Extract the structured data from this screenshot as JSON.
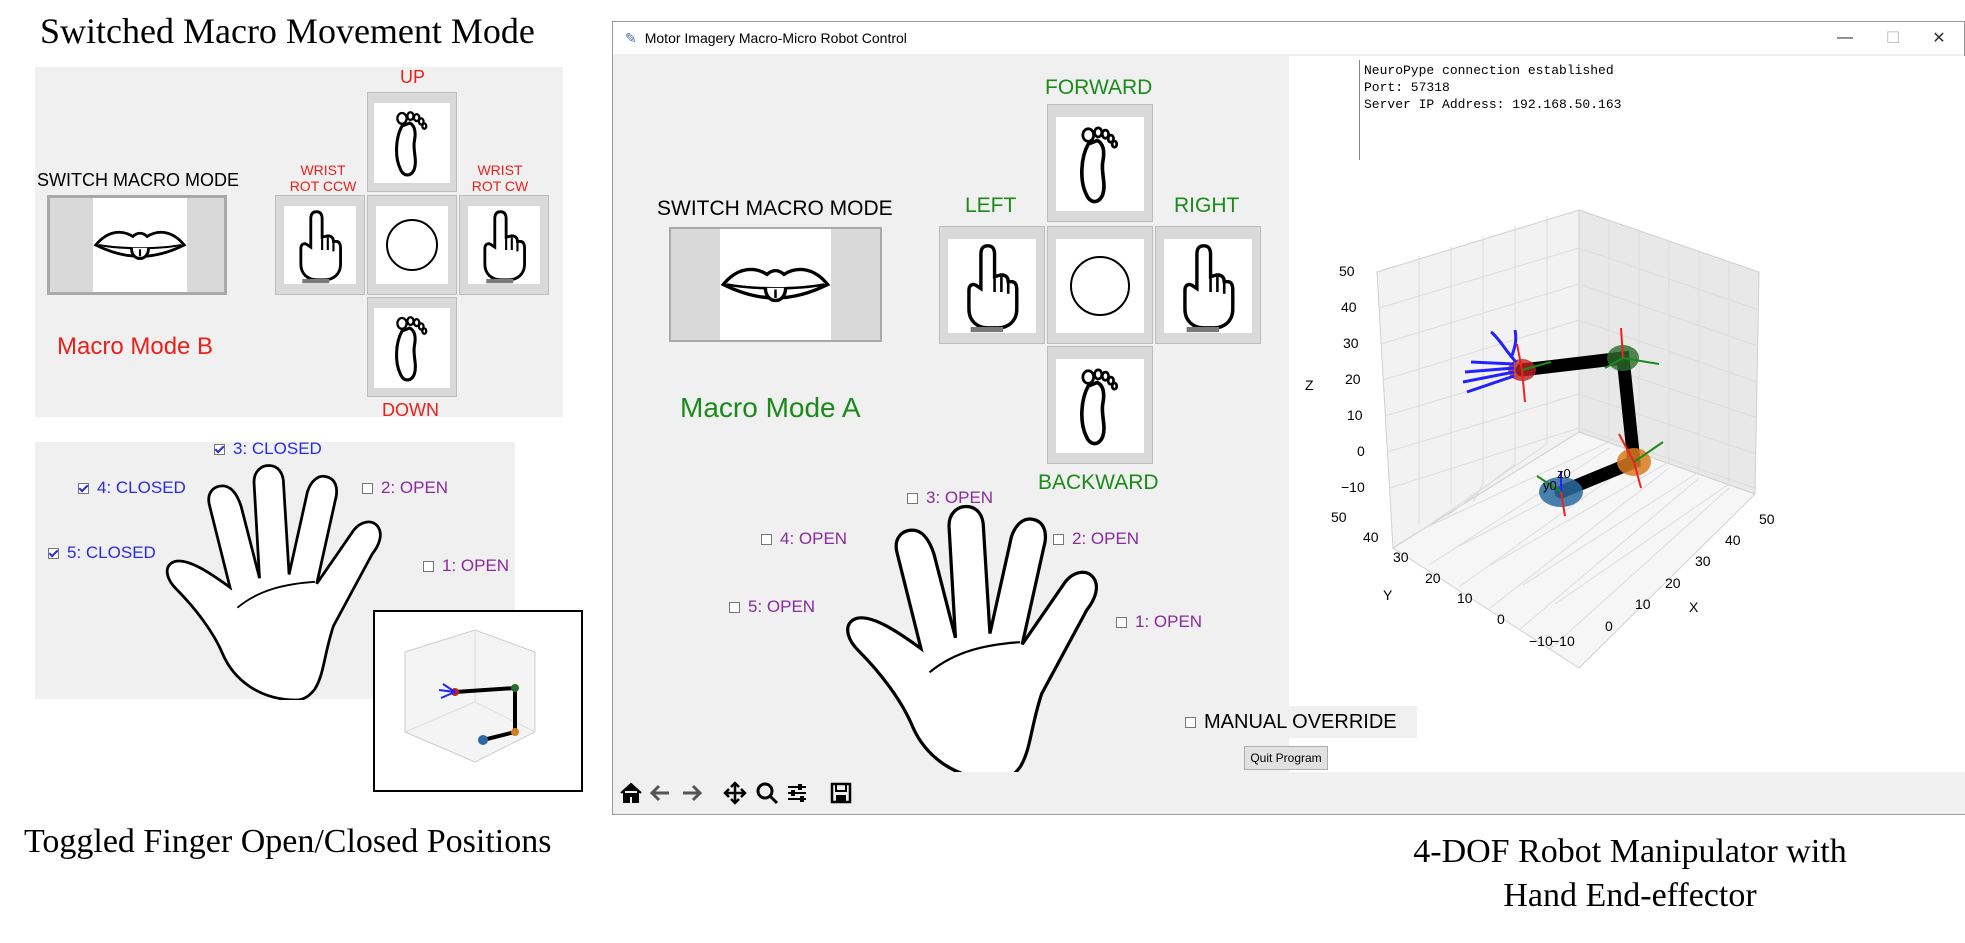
{
  "left_panel": {
    "heading": "Switched Macro Movement Mode",
    "macro_panel": {
      "switch_label": "SWITCH MACRO MODE",
      "up_label": "UP",
      "down_label": "DOWN",
      "wrist_ccw_label": [
        "WRIST",
        "ROT CCW"
      ],
      "wrist_cw_label": [
        "WRIST",
        "ROT CW"
      ],
      "mode_label": "Macro Mode B"
    },
    "fingers": [
      {
        "label": "3: CLOSED",
        "checked": true
      },
      {
        "label": "4: CLOSED",
        "checked": true
      },
      {
        "label": "2: OPEN",
        "checked": false
      },
      {
        "label": "5: CLOSED",
        "checked": true
      },
      {
        "label": "1: OPEN",
        "checked": false
      }
    ],
    "caption": "Toggled Finger Open/Closed Positions"
  },
  "window": {
    "title": "Motor Imagery Macro-Micro Robot Control",
    "controls": {
      "minimize": "—",
      "maximize": "☐",
      "close": "✕"
    },
    "macro_panel": {
      "switch_label": "SWITCH MACRO MODE",
      "forward_label": "FORWARD",
      "backward_label": "BACKWARD",
      "left_label": "LEFT",
      "right_label": "RIGHT",
      "mode_label": "Macro Mode A"
    },
    "fingers": [
      {
        "label": "3: OPEN",
        "checked": false
      },
      {
        "label": "4: OPEN",
        "checked": false
      },
      {
        "label": "2: OPEN",
        "checked": false
      },
      {
        "label": "5: OPEN",
        "checked": false
      },
      {
        "label": "1: OPEN",
        "checked": false
      }
    ],
    "manual_override": {
      "label": "MANUAL OVERRIDE",
      "checked": false
    },
    "quit_label": "Quit Program",
    "console_lines": [
      "NeuroPype connection established",
      "Port: 57318",
      "Server IP Address: 192.168.50.163"
    ],
    "plot": {
      "z_label": "Z",
      "x_label": "X",
      "y_label": "Y",
      "z_ticks": [
        "50",
        "40",
        "30",
        "20",
        "10",
        "0",
        "−10"
      ],
      "x_ticks": [
        "−10",
        "0",
        "10",
        "20",
        "30",
        "40",
        "50"
      ],
      "y_ticks": [
        "50",
        "40",
        "30",
        "20",
        "10",
        "0",
        "−10"
      ],
      "frame_labels": [
        "y0",
        "z0"
      ]
    },
    "toolbar": [
      "home-icon",
      "back-icon",
      "forward-icon",
      "pan-icon",
      "zoom-icon",
      "configure-icon",
      "save-icon"
    ]
  },
  "right_caption": [
    "4-DOF Robot Manipulator with",
    "Hand End-effector"
  ],
  "colors": {
    "red": "#e8211b",
    "green": "#1a8a1a",
    "purple": "#8a2a9e",
    "blue": "#2a2ae0"
  }
}
